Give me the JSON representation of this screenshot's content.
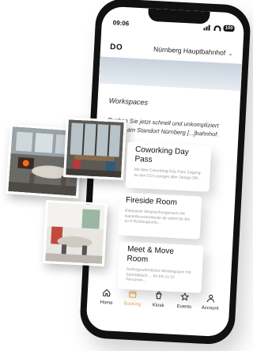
{
  "status": {
    "time": "09:06",
    "battery": "100"
  },
  "header": {
    "logo": "DO",
    "location": "Nürnberg Hauptbahnhof"
  },
  "workspaces": {
    "title": "Workspaces",
    "intro": "Buchen Sie jetzt schnell und unkompliziert [...] um am Standort Nürnberg [...]bahnhof."
  },
  "cards": [
    {
      "title": "Coworking Day Pass",
      "desc": "Mit dem Coworking Day Pass Zugang zu den CO-Lounges aller Design Off..."
    },
    {
      "title": "Fireside Room",
      "desc": "Exklusiver Besprechungsraum mit Kaminfeuerambiente ab sofort für bis zu 6 Rückzugsorte..."
    },
    {
      "title": "Meet & Move Room",
      "desc": "Außergewöhnlicher Meetingraum mit Schreibtisch ... für bis zu 12 Personen..."
    }
  ],
  "tabs": [
    {
      "label": "Home",
      "icon": "home-icon",
      "active": false
    },
    {
      "label": "Booking",
      "icon": "booking-icon",
      "active": true
    },
    {
      "label": "Kiosk",
      "icon": "kiosk-icon",
      "active": false
    },
    {
      "label": "Events",
      "icon": "star-icon",
      "active": false
    },
    {
      "label": "Account",
      "icon": "account-icon",
      "active": false
    }
  ],
  "colors": {
    "accent": "#e9a84a",
    "phone": "#111111"
  }
}
